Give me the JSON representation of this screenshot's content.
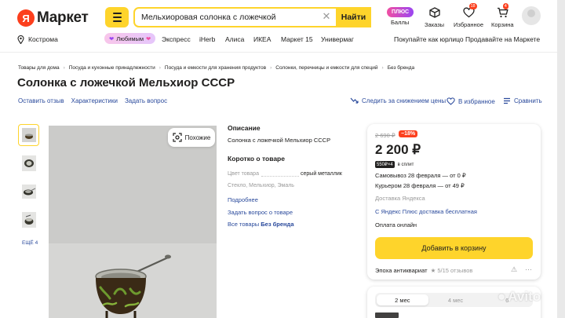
{
  "header": {
    "logo_text": "Маркет",
    "search_value": "Мельхиоровая солонка с ложечкой",
    "search_button": "Найти",
    "plus_badge": "ПЛЮС",
    "items": [
      {
        "label": "Баллы",
        "icon": "plus-points-icon"
      },
      {
        "label": "Заказы",
        "icon": "box-icon"
      },
      {
        "label": "Избранное",
        "icon": "heart-icon",
        "count": "18"
      },
      {
        "label": "Корзина",
        "icon": "cart-icon",
        "count": "4"
      }
    ]
  },
  "nav": {
    "location": "Кострома",
    "favorites_pill": "Любимым",
    "links": [
      "Экспресс",
      "iHerb",
      "Алиса",
      "ИКЕА",
      "Маркет 15",
      "Универмаг"
    ],
    "legal_entity": "Покупайте как юрлицо",
    "sell": "Продавайте на Маркете"
  },
  "breadcrumbs": [
    "Товары для дома",
    "Посуда и кухонные принадлежности",
    "Посуда и емкости для хранения продуктов",
    "Солонки, перечницы и емкости для специй",
    "Без бренда"
  ],
  "product": {
    "title": "Солонка с ложечкой Мельхиор СССР",
    "actions": [
      "Оставить отзыв",
      "Характеристики",
      "Задать вопрос"
    ],
    "track_price": "Следить за снижением цены",
    "to_favorites": "В избранное",
    "compare": "Сравнить",
    "more_photos": "ЕЩЁ 4",
    "similar": "Похожие"
  },
  "description": {
    "heading": "Описание",
    "text": "Солонка с ложечкой Мельхиор СССР",
    "short_heading": "Коротко о товаре",
    "color_key": "Цвет товара",
    "color_value": "серый металлик",
    "materials": "Стекло, Мельхиор, Эмаль",
    "more_link": "Подробнее",
    "ask_link": "Задать вопрос о товаре",
    "all_goods": "Все товары",
    "brand": "Без бренда"
  },
  "buy": {
    "old_price": "2 690 ₽",
    "discount": "−18%",
    "price": "2 200 ₽",
    "split_badge": "550₽×4",
    "split_text": "в сплит",
    "pickup": "Самовывоз 28 февраля — от 0 ₽",
    "courier": "Курьером 28 февраля — от 49 ₽",
    "delivery_by": "Доставка Яндекса",
    "plus_delivery": "С Яндекс Плюс доставка бесплатная",
    "payment": "Оплата онлайн",
    "cart_button": "Добавить в корзину",
    "seller": "Эпоха антиквариат",
    "rating": "★ 5/15 отзывов"
  },
  "installments": {
    "tabs": [
      "2 мес",
      "4 мес",
      "6"
    ],
    "selected": "2 мес"
  },
  "watermark": "Avito",
  "colors": {
    "accent": "#fed42b",
    "link": "#2a4a9c",
    "discount": "#fc3f1d"
  }
}
